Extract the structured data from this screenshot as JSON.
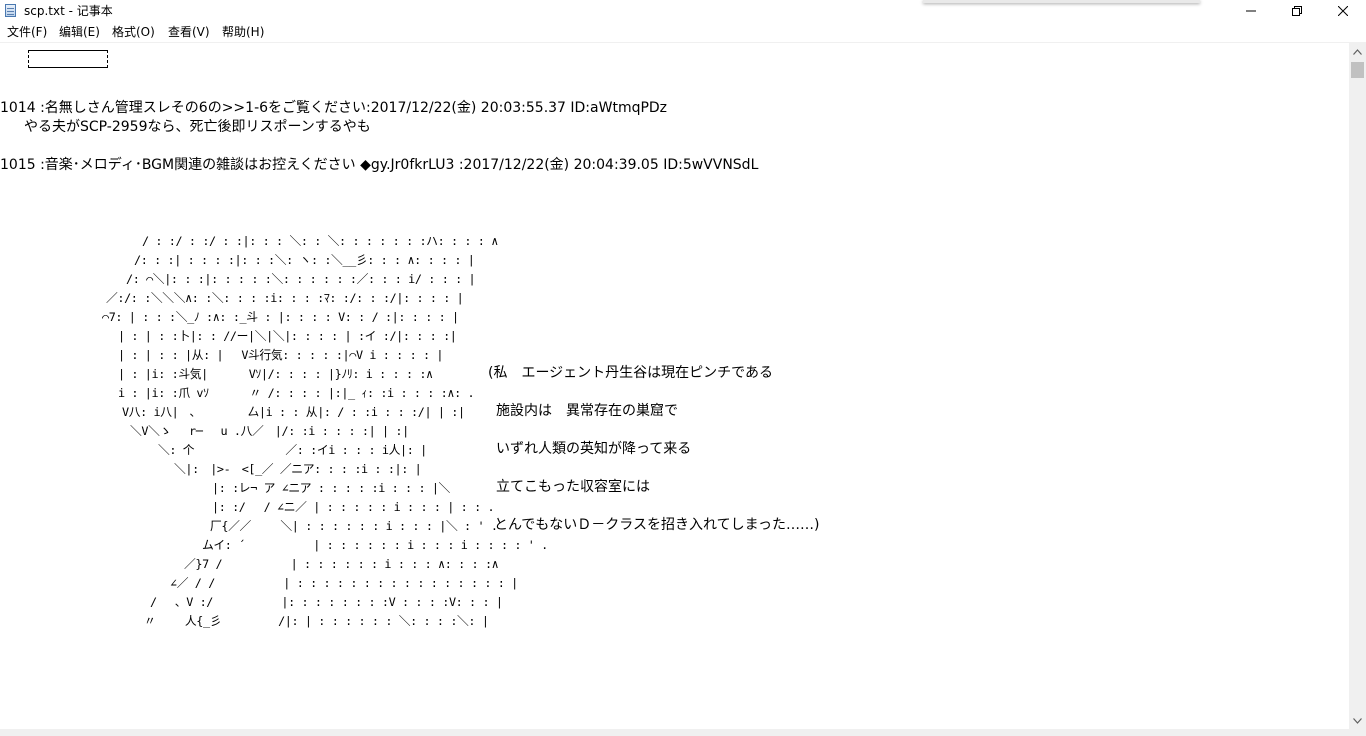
{
  "window": {
    "title": "scp.txt - 记事本",
    "icon": "notepad-icon",
    "controls": {
      "minimize": "minimize-icon",
      "maximize": "restore-icon",
      "close": "close-icon"
    }
  },
  "menu": [
    {
      "label": "文件(F)"
    },
    {
      "label": "编辑(E)"
    },
    {
      "label": "格式(O)"
    },
    {
      "label": "查看(V)"
    },
    {
      "label": "帮助(H)"
    }
  ],
  "document": {
    "lines": [
      "1014 :名無しさん管理スレその6の>>1-6をご覧ください:2017/12/22(金) 20:03:55.37 ID:aWtmqPDz",
      "　やる夫がSCP-2959なら、死亡後即リスポーンするやも",
      "1015 :音楽･メロディ･BGM関連の雑談はお控えください ◆gy.Jr0fkrLU3 :2017/12/22(金) 20:04:39.05 ID:5wVVNSdL"
    ],
    "ascii_art": [
      "/ : :/ : :/ : :|: : : ＼: : ＼: : : : : : :ハ: : : : ∧",
      "/: : :| : : : :|: : :＼: ヽ: :＼__彡: : : ∧: : : : |",
      "/: ⌒＼|: : :|: : : : :＼: : : : : :／: : : i/ : : : |",
      "／:/: :＼＼＼∧: :＼: : : :i: : : :ﾏ: :/: : :/|: : : : |",
      "⌒7: | : : :＼_ﾉ :∧: :_斗 : |: : : : V: : / :|: : : : |",
      "| : | : :卜|: : //ー|＼|＼|: : : : | :イ :/|: : : :|",
      "| : | : : |从: |　 V斗行気: : : : :|⌒V i : : : : |",
      "| : |i: :斗気|　　　 Vｿ|/: : : : |}ﾉﾘ: i : : : :∧",
      "i : |i: :爪 vｿ　　　 〃 /: : : : |:|_ ｨ: :i : : : :∧: .",
      "V八: i八|　､　　　　 厶|i : : 从|: / : :i : : :/| | :|",
      "＼V＼ゝ　 r─　 u .八／　|/: :i : : : :| | :|",
      "＼: 个　　　　　　　　／: :イi : : : i人|: |",
      "＼|:　|>‐　<[_／ ／ニア: : : :i : :|: |",
      "|: :レ¬ ア ∠ニア : : : : :i : : : |＼",
      "|: :/　 / ∠ニ／ | : : : : : i : : : | : : .",
      "厂{／／　　 ＼| : : : : : : i : : : |＼ : ' .",
      "ムイ: ´　　　　　　| : : : : : : i : : : i : : : : ' .",
      "／}7 /　　　　　　| : : : : : : i : : : ∧: : : :∧",
      "∠／ / /　　　　　　| : : : : : : : : : : : : : : : : |",
      "/　 、V :/　　　　　　|: : : : : : : :V : : : :V: : : |",
      "〃　　 人{_彡　　　　　/|: | : : : : : : ＼: : : :＼: |"
    ],
    "narration": [
      "(私　エージェント丹生谷は現在ピンチである",
      "施設内は　異常存在の巣窟で",
      "いずれ人類の英知が降って来る",
      "立てこもった収容室には",
      "とんでもないＤ－クラスを招き入れてしまった……)"
    ]
  },
  "scrollbar": {
    "up": "scroll-up-icon",
    "down": "scroll-down-icon"
  }
}
